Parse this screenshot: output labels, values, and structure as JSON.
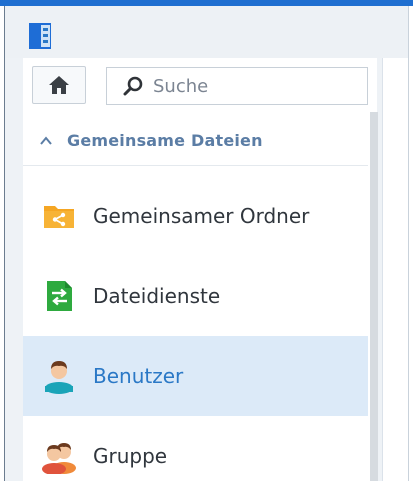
{
  "search": {
    "placeholder": "Suche"
  },
  "section": {
    "title": "Gemeinsame Dateien",
    "expanded": true
  },
  "items": [
    {
      "label": "Gemeinsamer Ordner",
      "icon": "shared-folder-icon",
      "color": "#f5a623"
    },
    {
      "label": "Dateidienste",
      "icon": "file-services-icon",
      "color": "#2eaa3f"
    },
    {
      "label": "Benutzer",
      "icon": "user-icon",
      "color": "#1aa4b8",
      "selected": true
    },
    {
      "label": "Gruppe",
      "icon": "group-icon",
      "color": "#e0533c"
    }
  ],
  "colors": {
    "accent": "#2a78c6",
    "selected_bg": "#dceaf8",
    "section_header": "#5b7da5"
  }
}
